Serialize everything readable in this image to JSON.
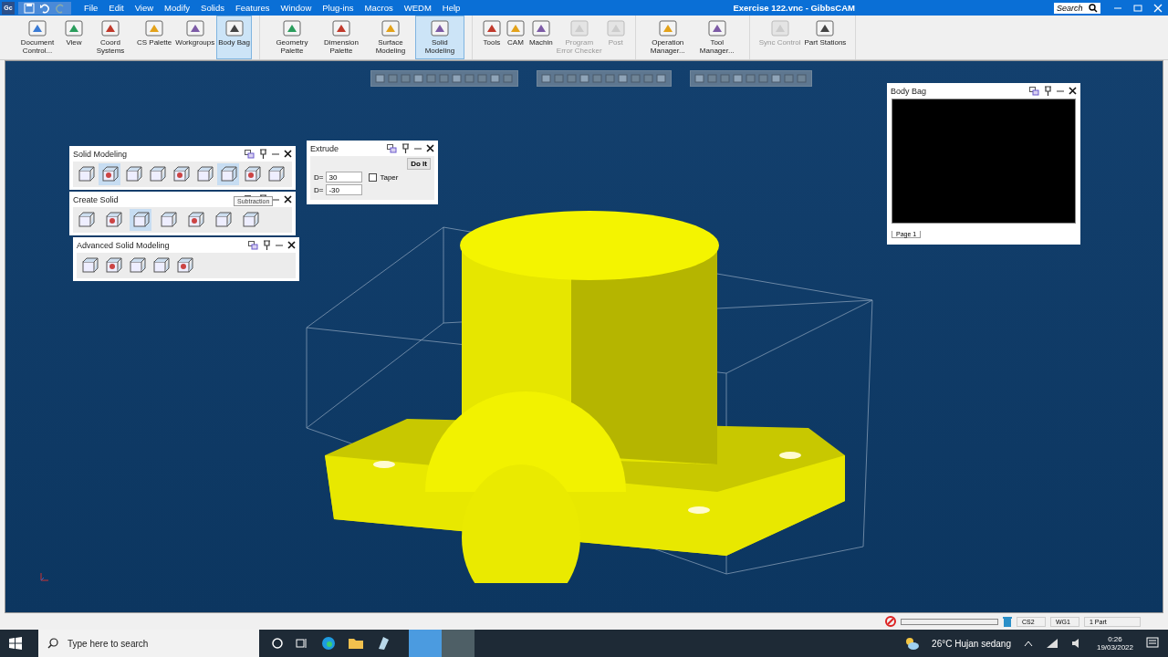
{
  "window": {
    "app_badge": "Gc",
    "title": "Exercise 122.vnc - GibbsCAM",
    "search_placeholder": "Search"
  },
  "menu": [
    "File",
    "Edit",
    "View",
    "Modify",
    "Solids",
    "Features",
    "Window",
    "Plug-ins",
    "Macros",
    "WEDM",
    "Help"
  ],
  "ribbon": [
    {
      "buttons": [
        {
          "label": "Document Control...",
          "selected": false,
          "disabled": false
        },
        {
          "label": "View",
          "selected": false,
          "disabled": false
        },
        {
          "label": "Coord Systems",
          "selected": false,
          "disabled": false
        },
        {
          "label": "CS Palette",
          "selected": false,
          "disabled": false
        },
        {
          "label": "Workgroups",
          "selected": false,
          "disabled": false
        },
        {
          "label": "Body Bag",
          "selected": true,
          "disabled": false
        }
      ]
    },
    {
      "buttons": [
        {
          "label": "Geometry Palette",
          "selected": false,
          "disabled": false
        },
        {
          "label": "Dimension Palette",
          "selected": false,
          "disabled": false
        },
        {
          "label": "Surface Modeling",
          "selected": false,
          "disabled": false
        },
        {
          "label": "Solid Modeling",
          "selected": true,
          "disabled": false
        }
      ]
    },
    {
      "buttons": [
        {
          "label": "Tools",
          "selected": false,
          "disabled": false
        },
        {
          "label": "CAM",
          "selected": false,
          "disabled": false
        },
        {
          "label": "Machin",
          "selected": false,
          "disabled": false
        },
        {
          "label": "Program Error Checker",
          "selected": false,
          "disabled": true
        },
        {
          "label": "Post",
          "selected": false,
          "disabled": true
        }
      ]
    },
    {
      "buttons": [
        {
          "label": "Operation Manager...",
          "selected": false,
          "disabled": false
        },
        {
          "label": "Tool Manager...",
          "selected": false,
          "disabled": false
        }
      ]
    },
    {
      "buttons": [
        {
          "label": "Sync Control",
          "selected": false,
          "disabled": true
        },
        {
          "label": "Part Stations",
          "selected": false,
          "disabled": false
        }
      ]
    }
  ],
  "palettes": [
    {
      "title": "Solid Modeling",
      "tools": [
        {
          "selected": false
        },
        {
          "selected": true
        },
        {
          "selected": false
        },
        {
          "selected": false
        },
        {
          "selected": false
        },
        {
          "selected": false
        },
        {
          "selected": true
        },
        {
          "selected": false
        },
        {
          "selected": false
        }
      ]
    },
    {
      "title": "Create Solid",
      "tools": [
        {
          "selected": false
        },
        {
          "selected": false
        },
        {
          "selected": true
        },
        {
          "selected": false
        },
        {
          "selected": false
        },
        {
          "selected": false
        },
        {
          "selected": false
        }
      ]
    },
    {
      "title": "Advanced Solid Modeling",
      "tools": [
        {
          "selected": false
        },
        {
          "selected": false
        },
        {
          "selected": false
        },
        {
          "selected": false
        },
        {
          "selected": false
        }
      ]
    }
  ],
  "tooltip": "Subtraction",
  "extrude": {
    "title": "Extrude",
    "button": "Do It",
    "fields": [
      {
        "label": "D=",
        "value": "30"
      },
      {
        "label": "D=",
        "value": "-30"
      }
    ],
    "taper": {
      "label": "Taper",
      "checked": false
    }
  },
  "body_bag": {
    "title": "Body Bag",
    "tab": "Page 1"
  },
  "status_bar": {
    "progress": {
      "level": 0
    },
    "items": [
      "CS2",
      "WG1",
      "1 Part"
    ]
  },
  "taskbar": {
    "search_placeholder": "Type here to search",
    "weather": "26°C  Hujan sedang",
    "time": "0:26",
    "date": "19/03/2022"
  }
}
